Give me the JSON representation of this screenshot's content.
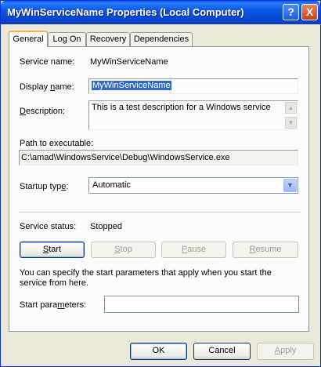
{
  "window": {
    "title": "MyWinServiceName Properties (Local Computer)",
    "help_glyph": "?",
    "close_glyph": "X"
  },
  "tabs": [
    {
      "label": "General",
      "active": true
    },
    {
      "label": "Log On",
      "active": false
    },
    {
      "label": "Recovery",
      "active": false
    },
    {
      "label": "Dependencies",
      "active": false
    }
  ],
  "general": {
    "service_name_label": "Service name:",
    "service_name_value": "MyWinServiceName",
    "display_name_label_pre": "Display ",
    "display_name_label_key": "n",
    "display_name_label_post": "ame:",
    "display_name_value": "MyWinServiceName",
    "description_label_key": "D",
    "description_label_post": "escription:",
    "description_value": "This is a test description for a Windows service",
    "path_label": "Path to executable:",
    "path_value": "C:\\amad\\WindowsService\\Debug\\WindowsService.exe",
    "startup_label_pre": "Startup typ",
    "startup_label_key": "e",
    "startup_label_post": ":",
    "startup_value": "Automatic",
    "status_label": "Service status:",
    "status_value": "Stopped",
    "buttons": {
      "start_key": "S",
      "start_rest": "tart",
      "stop_key": "S",
      "stop_rest": "top",
      "pause_key": "P",
      "pause_rest": "ause",
      "resume_key": "R",
      "resume_rest": "esume"
    },
    "help_text": "You can specify the start parameters that apply when you start the service from here.",
    "start_params_label": "Start para",
    "start_params_key": "m",
    "start_params_post": "eters:",
    "start_params_value": ""
  },
  "dialog_buttons": {
    "ok": "OK",
    "cancel": "Cancel",
    "apply_key": "A",
    "apply_rest": "pply"
  }
}
